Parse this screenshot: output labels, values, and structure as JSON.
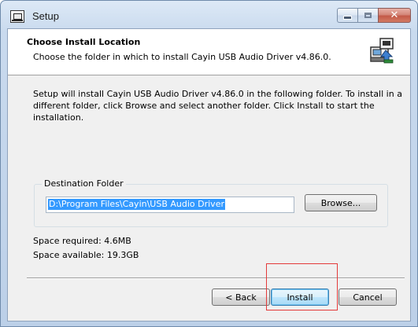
{
  "window": {
    "title": "Setup"
  },
  "caption_buttons": {
    "minimize_icon": "minimize-icon",
    "maximize_icon": "maximize-icon",
    "close_label": "✕"
  },
  "header": {
    "title": "Choose Install Location",
    "subtitle": "Choose the folder in which to install Cayin USB Audio Driver v4.86.0.",
    "icon": "installer-icon"
  },
  "body": {
    "intro": "Setup will install Cayin USB Audio Driver v4.86.0 in the following folder. To install in a different folder, click Browse and select another folder. Click Install to start the installation."
  },
  "destination": {
    "group_label": "Destination Folder",
    "path": "D:\\Program Files\\Cayin\\USB Audio Driver",
    "browse_label": "Browse..."
  },
  "space": {
    "required": "Space required: 4.6MB",
    "available": "Space available: 19.3GB"
  },
  "footer": {
    "back_label": "< Back",
    "install_label": "Install",
    "cancel_label": "Cancel"
  },
  "colors": {
    "selection": "#3399ff",
    "highlight_box": "#e33a3a",
    "title_gradient_top": "#dde9f6"
  }
}
